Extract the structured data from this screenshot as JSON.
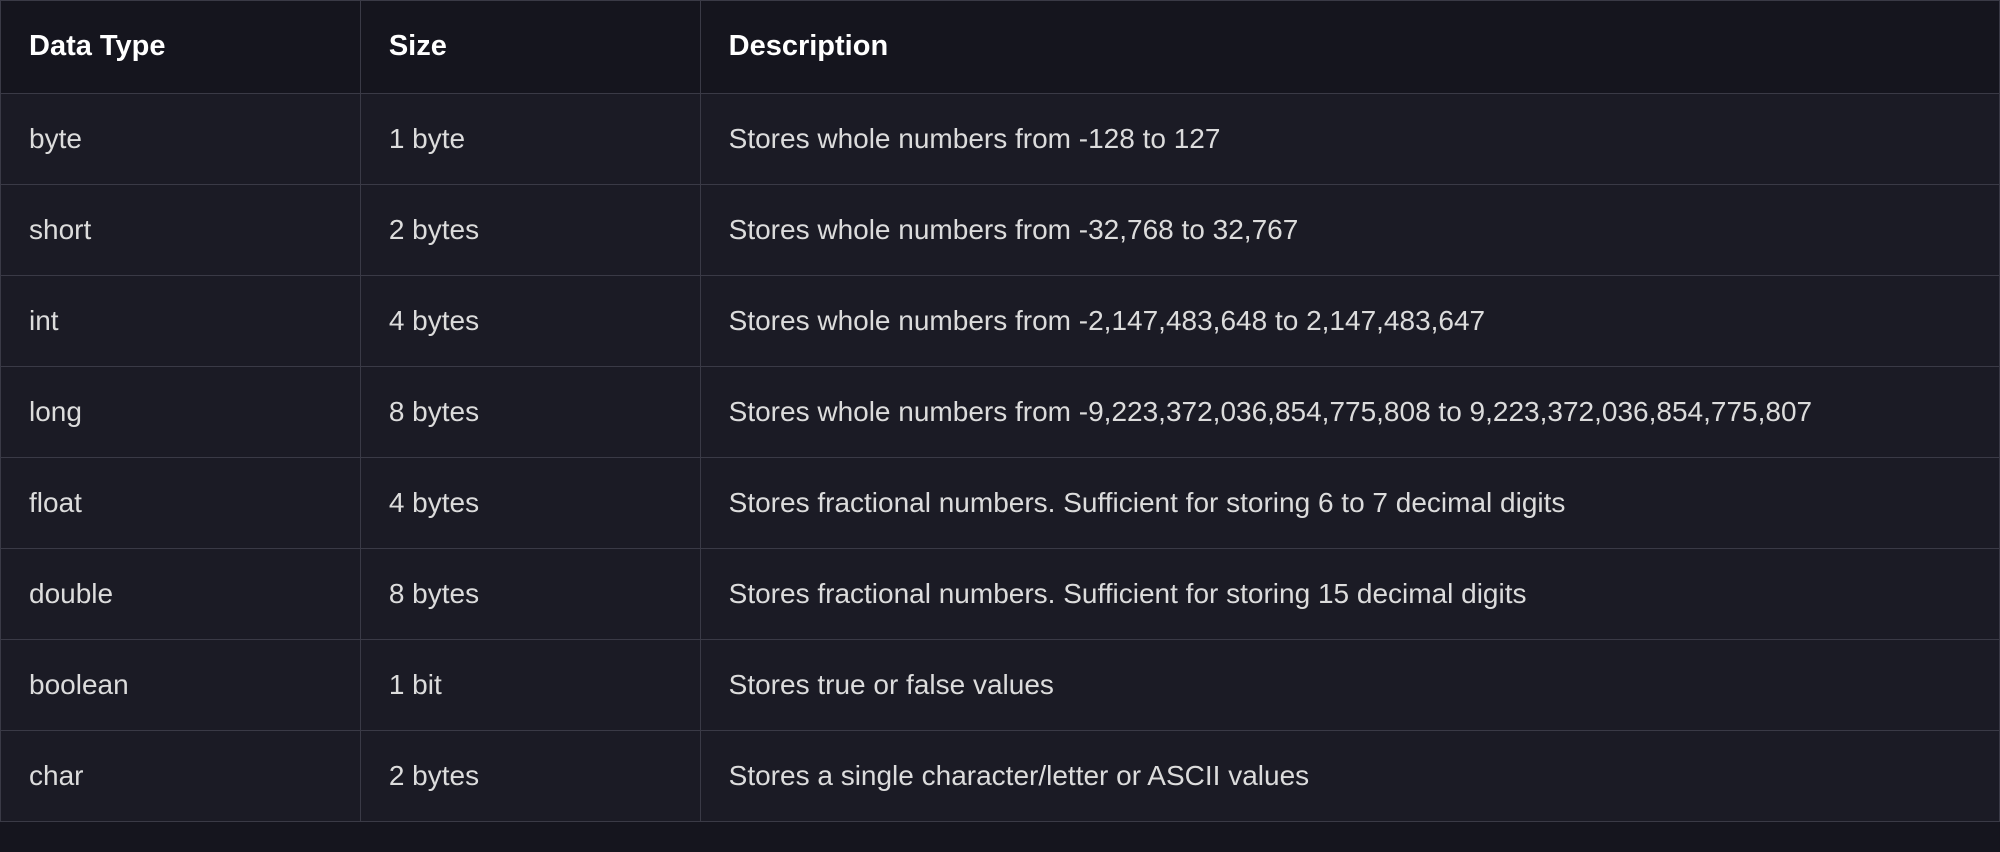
{
  "table": {
    "headers": [
      "Data Type",
      "Size",
      "Description"
    ],
    "rows": [
      {
        "type": "byte",
        "size": "1 byte",
        "desc": "Stores whole numbers from -128 to 127"
      },
      {
        "type": "short",
        "size": "2 bytes",
        "desc": "Stores whole numbers from -32,768 to 32,767"
      },
      {
        "type": "int",
        "size": "4 bytes",
        "desc": "Stores whole numbers from -2,147,483,648 to 2,147,483,647"
      },
      {
        "type": "long",
        "size": "8 bytes",
        "desc": "Stores whole numbers from -9,223,372,036,854,775,808 to 9,223,372,036,854,775,807"
      },
      {
        "type": "float",
        "size": "4 bytes",
        "desc": "Stores fractional numbers. Sufficient for storing 6 to 7 decimal digits"
      },
      {
        "type": "double",
        "size": "8 bytes",
        "desc": "Stores fractional numbers. Sufficient for storing 15 decimal digits"
      },
      {
        "type": "boolean",
        "size": "1 bit",
        "desc": "Stores true or false values"
      },
      {
        "type": "char",
        "size": "2 bytes",
        "desc": "Stores a single character/letter or ASCII values"
      }
    ]
  }
}
